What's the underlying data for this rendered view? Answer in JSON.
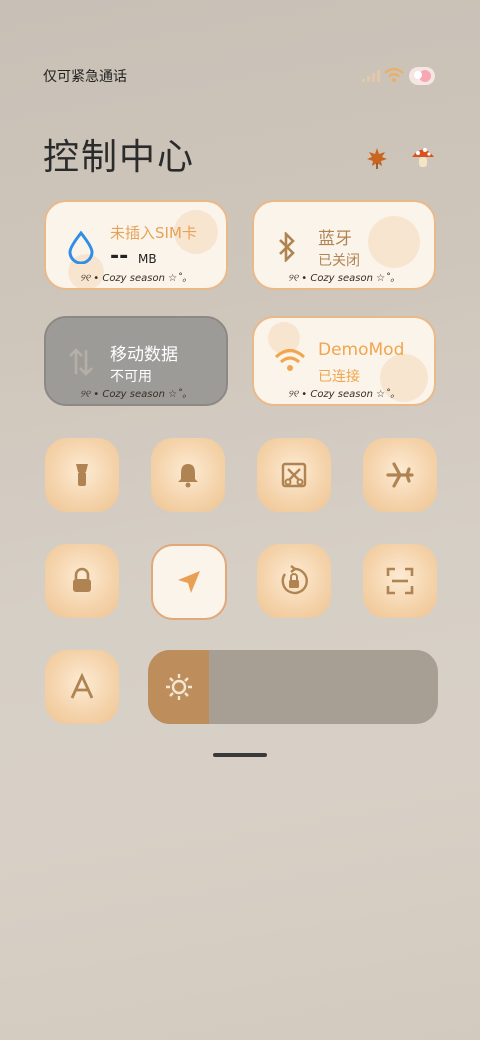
{
  "status_bar": {
    "carrier_text": "仅可紧急通话"
  },
  "header": {
    "title": "控制中心"
  },
  "cards": {
    "data_usage": {
      "title": "未插入SIM卡",
      "value": "--",
      "unit": "MB",
      "footer": "୨୧ • Cozy season ☆˚。"
    },
    "bluetooth": {
      "title": "蓝牙",
      "status": "已关闭",
      "footer": "୨୧ • Cozy season ☆˚。"
    },
    "mobile_data": {
      "title": "移动数据",
      "status": "不可用",
      "footer": "୨୧ • Cozy season ☆˚。"
    },
    "wifi": {
      "title": "DemoMod",
      "status": "已连接",
      "footer": "୨୧ • Cozy season ☆˚。"
    }
  },
  "icons": [
    "flashlight-icon",
    "bell-icon",
    "screenshot-icon",
    "airplane-icon",
    "lock-icon",
    "location-icon",
    "rotation-lock-icon",
    "scan-icon",
    "font-icon",
    "sun-icon"
  ],
  "brightness": {
    "level_percent": 21
  },
  "colors": {
    "accent": "#b08452",
    "card_border": "#e9b98a",
    "tile": "#f4d2a9"
  }
}
